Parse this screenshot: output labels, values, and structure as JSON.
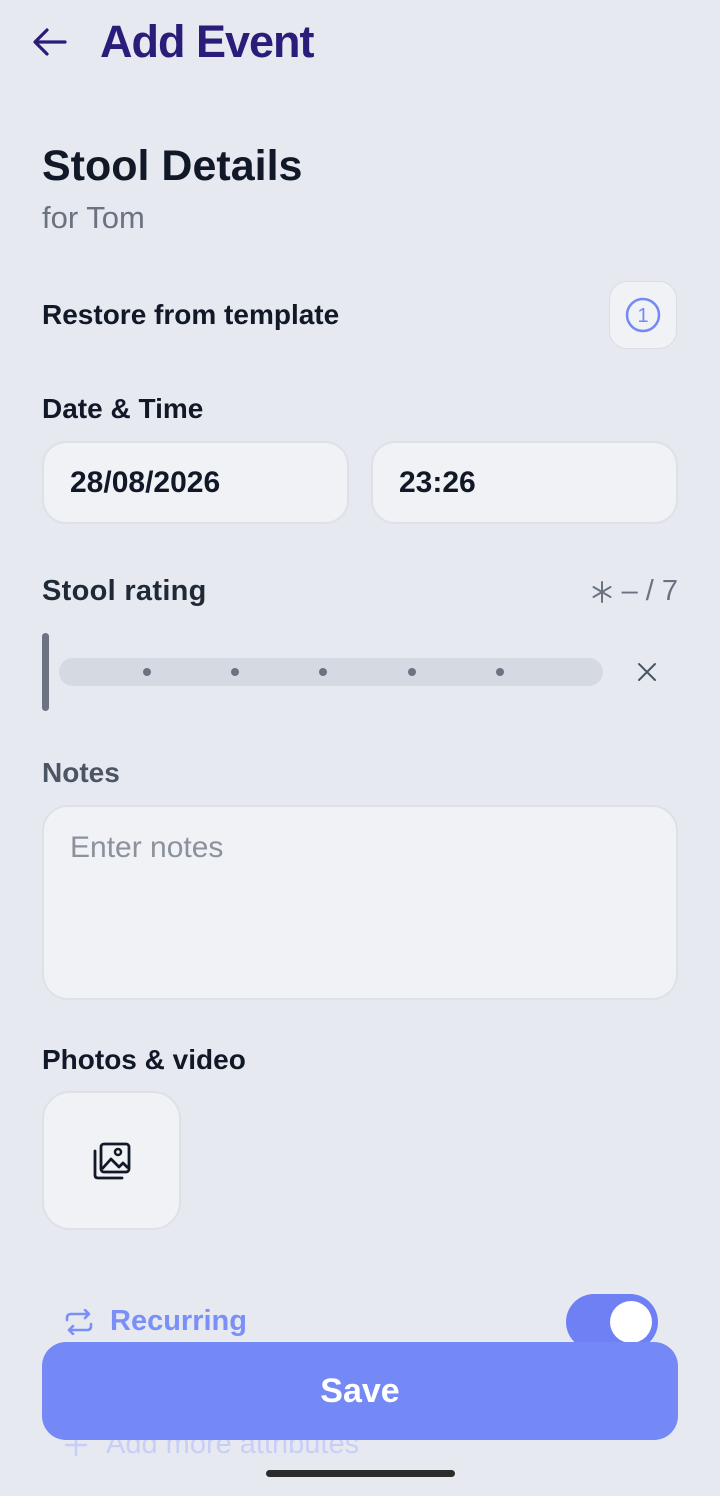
{
  "header": {
    "title": "Add Event",
    "back_icon": "arrow-left-icon"
  },
  "section": {
    "title": "Stool Details",
    "subtitle": "for Tom"
  },
  "template": {
    "label": "Restore from template",
    "count": "1"
  },
  "datetime": {
    "label": "Date & Time",
    "date": "28/08/2026",
    "time": "23:26"
  },
  "rating": {
    "label": "Stool rating",
    "value": "–",
    "max": "/ 7",
    "ticks": 5
  },
  "notes": {
    "label": "Notes",
    "placeholder": "Enter notes",
    "value": ""
  },
  "media": {
    "label": "Photos & video",
    "icon": "gallery-icon"
  },
  "recurring": {
    "label": "Recurring",
    "enabled": true
  },
  "more": {
    "label": "Add more attributes"
  },
  "save": {
    "label": "Save"
  },
  "colors": {
    "accent": "#7589f6",
    "title": "#2a1d7a",
    "background": "#e6e9f0"
  }
}
